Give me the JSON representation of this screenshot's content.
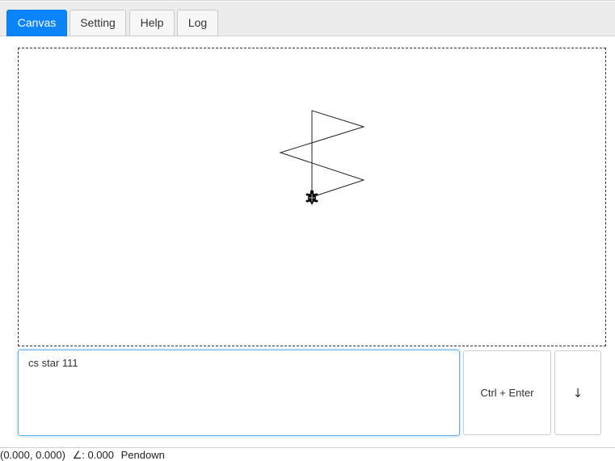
{
  "tabs": [
    {
      "label": "Canvas",
      "active": true
    },
    {
      "label": "Setting",
      "active": false
    },
    {
      "label": "Help",
      "active": false
    },
    {
      "label": "Log",
      "active": false
    }
  ],
  "command": {
    "value": "cs star 111"
  },
  "buttons": {
    "run_label": "Ctrl + Enter",
    "down_label": "↓"
  },
  "status": {
    "position": "(0.000, 0.000)",
    "heading_symbol": "∠: 0.000",
    "pen_state": "Pendown"
  },
  "turtle": {
    "icon": "turtle-icon",
    "color": "#000000"
  },
  "colors": {
    "accent": "#0a84ff"
  }
}
